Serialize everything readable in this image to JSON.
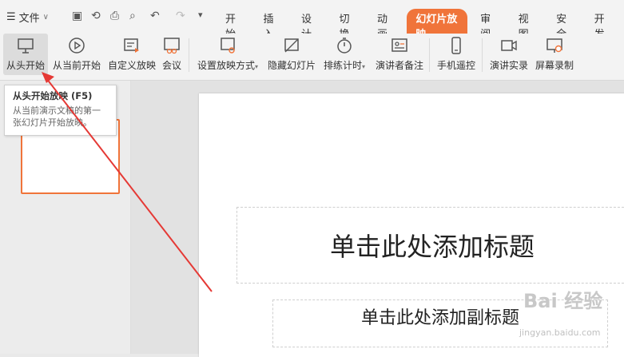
{
  "quick": {
    "file": "文件"
  },
  "tabs": [
    "开始",
    "插入",
    "设计",
    "切换",
    "动画",
    "幻灯片放映",
    "审阅",
    "视图",
    "安全",
    "开发"
  ],
  "ribbon": [
    {
      "label": "从头开始",
      "icon": "slideshow-screen-icon"
    },
    {
      "label": "从当前开始",
      "icon": "play-circle-icon"
    },
    {
      "label": "自定义放映",
      "icon": "custom-slideshow-icon"
    },
    {
      "label": "会议",
      "icon": "meeting-icon"
    },
    {
      "label": "设置放映方式",
      "icon": "settings-screen-icon"
    },
    {
      "label": "隐藏幻灯片",
      "icon": "hide-slide-icon"
    },
    {
      "label": "排练计时",
      "icon": "timer-icon"
    },
    {
      "label": "演讲者备注",
      "icon": "speaker-notes-icon"
    },
    {
      "label": "手机遥控",
      "icon": "phone-icon"
    },
    {
      "label": "演讲实录",
      "icon": "record-video-icon"
    },
    {
      "label": "屏幕录制",
      "icon": "screen-record-icon"
    }
  ],
  "tooltip": {
    "title": "从头开始放映 (F5)",
    "desc": "从当前演示文稿的第一张幻灯片开始放映。"
  },
  "slide": {
    "title": "单击此处添加标题",
    "subtitle": "单击此处添加副标题"
  },
  "watermark": {
    "logo": "Bai 经验",
    "url": "jingyan.baidu.com"
  },
  "colors": {
    "accent": "#f0743a",
    "arrow": "#e53935"
  }
}
